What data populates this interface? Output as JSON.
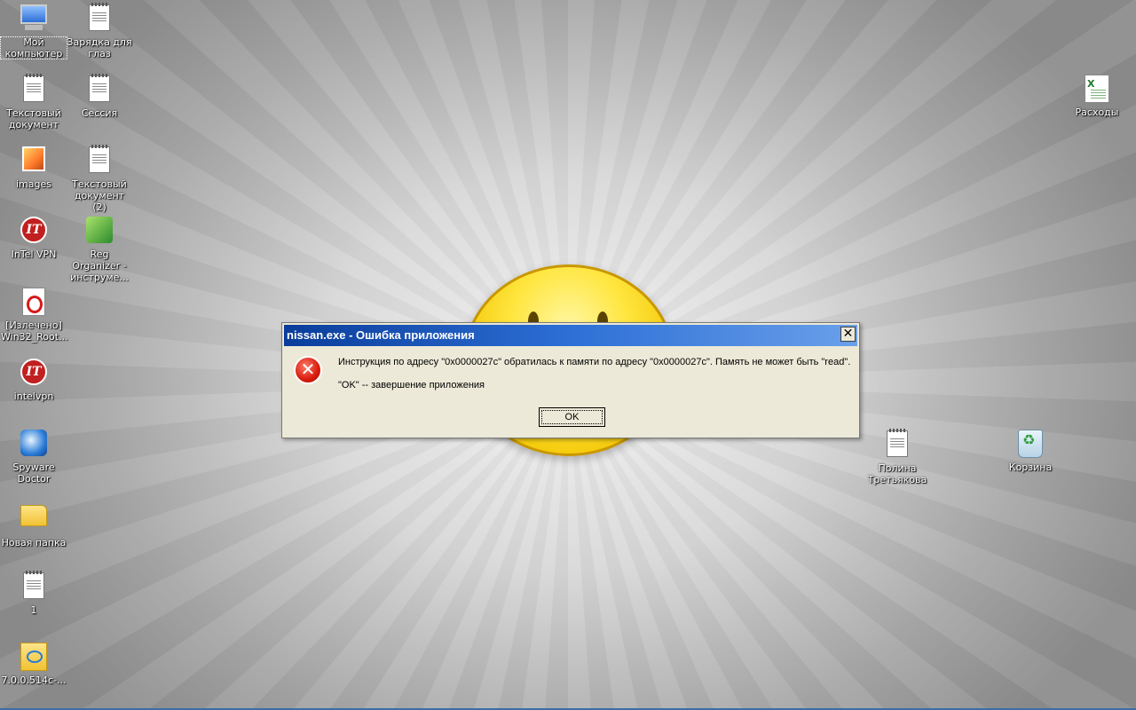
{
  "desktop": {
    "icons": [
      {
        "label": "Мой компьютер",
        "icon": "my-computer-icon",
        "selected": true
      },
      {
        "label": "Зарядка для глаз",
        "icon": "text-document-icon"
      },
      {
        "label": "Текстовый документ",
        "icon": "text-document-icon"
      },
      {
        "label": "Сессия",
        "icon": "text-document-icon"
      },
      {
        "label": "images",
        "icon": "image-icon"
      },
      {
        "label": "Текстовый документ (2)",
        "icon": "text-document-icon"
      },
      {
        "label": "InTel VPN",
        "icon": "intel-vpn-icon"
      },
      {
        "label": "Reg Organizer - инструме...",
        "icon": "reg-organizer-icon"
      },
      {
        "label": "[Излечено] Win32_Root...",
        "icon": "opera-document-icon"
      },
      {
        "label": "intelvpn",
        "icon": "intel-vpn-icon"
      },
      {
        "label": "Spyware Doctor",
        "icon": "spyware-doctor-icon"
      },
      {
        "label": "Новая папка",
        "icon": "folder-icon"
      },
      {
        "label": "1",
        "icon": "text-document-icon"
      },
      {
        "label": "7.0.0.514c-...",
        "icon": "installer-folder-icon"
      },
      {
        "label": "Расходы",
        "icon": "excel-document-icon"
      },
      {
        "label": "Полина Третьякова",
        "icon": "text-document-icon"
      },
      {
        "label": "Корзина",
        "icon": "recycle-bin-icon"
      }
    ]
  },
  "dialog": {
    "title": "nissan.exe - Ошибка приложения",
    "close_glyph": "✕",
    "error_glyph": "✕",
    "message": "Инструкция по адресу \"0x0000027c\" обратилась к памяти по адресу \"0x0000027c\". Память не может быть \"read\".",
    "hint": "\"OK\" -- завершение приложения",
    "ok_label": "OK"
  },
  "colors": {
    "titlebar_start": "#0a3d9a",
    "titlebar_end": "#6aa0ea",
    "dialog_face": "#ece9d8",
    "error_red": "#d81b0d"
  }
}
